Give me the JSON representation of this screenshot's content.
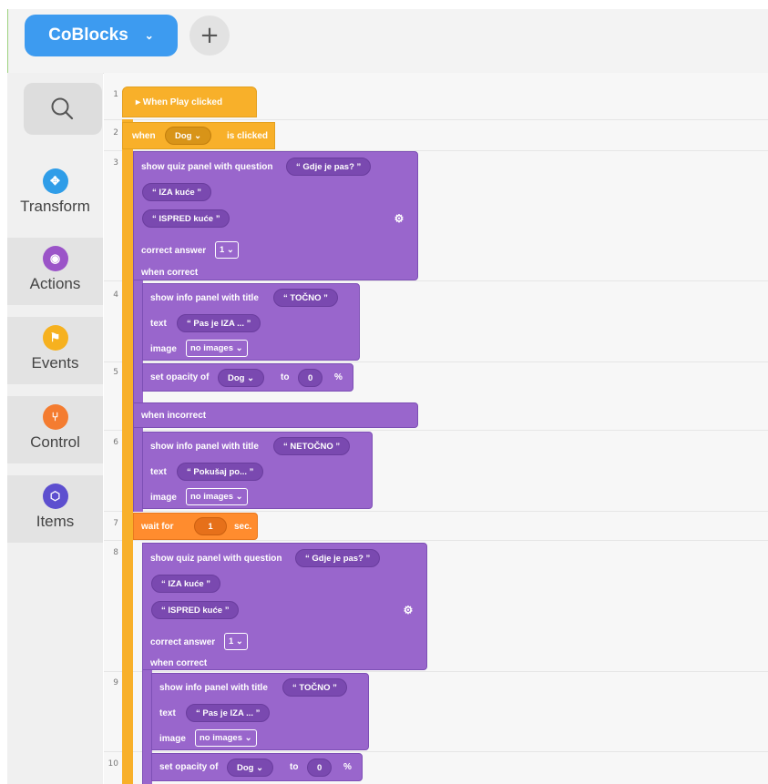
{
  "header": {
    "project_name": "CoBlocks",
    "project_chevron": "⌄",
    "add_label": "+"
  },
  "sidebar": {
    "search_icon": "search-icon",
    "categories": [
      {
        "label": "Transform",
        "icon": "move-arrows-icon",
        "color": "#2f9de8"
      },
      {
        "label": "Actions",
        "icon": "eye-icon",
        "color": "#9b54c8"
      },
      {
        "label": "Events",
        "icon": "flag-icon",
        "color": "#f6b11f"
      },
      {
        "label": "Control",
        "icon": "fork-arrows-icon",
        "color": "#f47c30"
      },
      {
        "label": "Items",
        "icon": "cube-icon",
        "color": "#5d4fcf"
      }
    ]
  },
  "lines": [
    "1",
    "2",
    "3",
    "4",
    "5",
    "6",
    "7",
    "8",
    "9",
    "10"
  ],
  "code": {
    "b1": {
      "label": "▸ When Play clicked"
    },
    "b2": {
      "when": "when",
      "object": "Dog",
      "clicked": "is clicked"
    },
    "b3": {
      "label": "show quiz panel with question",
      "question": "Gdje je pas?",
      "answer1": "IZA kuće",
      "answer2": "ISPRED kuće",
      "correct_label": "correct answer",
      "correct_value": "1",
      "when_correct": "when correct",
      "when_incorrect": "when incorrect"
    },
    "b4": {
      "label": "show info panel with title",
      "title": "TOČNO",
      "text_label": "text",
      "text": "Pas je IZA ...",
      "image_label": "image",
      "image": "no images"
    },
    "b5": {
      "label": "set opacity of",
      "object": "Dog",
      "to": "to",
      "value": "0",
      "unit": "%"
    },
    "b6": {
      "label": "show info panel with title",
      "title": "NETOČNO",
      "text_label": "text",
      "text": "Pokušaj po...",
      "image_label": "image",
      "image": "no images"
    },
    "b7": {
      "label": "wait for",
      "value": "1",
      "unit": "sec."
    },
    "b8": {
      "label": "show quiz panel with question",
      "question": "Gdje je pas?",
      "answer1": "IZA kuće",
      "answer2": "ISPRED kuće",
      "correct_label": "correct answer",
      "correct_value": "1",
      "when_correct": "when correct"
    },
    "b9": {
      "label": "show info panel with title",
      "title": "TOČNO",
      "text_label": "text",
      "text": "Pas je IZA ...",
      "image_label": "image",
      "image": "no images"
    },
    "b10": {
      "label": "set opacity of",
      "object": "Dog",
      "to": "to",
      "value": "0",
      "unit": "%"
    }
  }
}
